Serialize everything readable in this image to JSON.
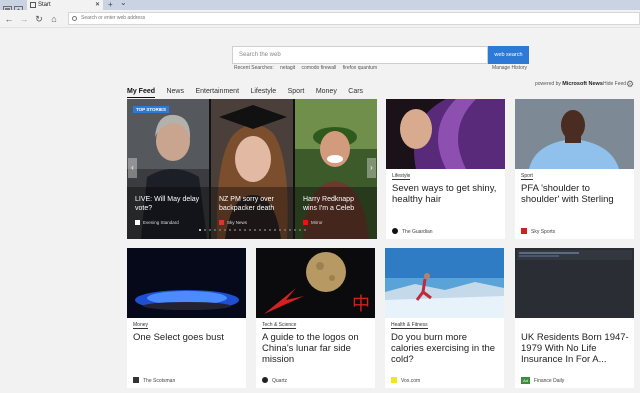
{
  "browser": {
    "tab_title": "Start",
    "new_tab": "+",
    "tab_menu": "⌄",
    "address_placeholder": "Search or enter web address"
  },
  "search": {
    "placeholder": "Search the web",
    "button_label": "web search",
    "recent_label": "Recent Searches:",
    "recent_items": [
      "netagit",
      "comodo firewall",
      "firefox quantum"
    ],
    "manage_history": "Manage History"
  },
  "categories": [
    "My Feed",
    "News",
    "Entertainment",
    "Lifestyle",
    "Sport",
    "Money",
    "Cars"
  ],
  "active_category": "My Feed",
  "powered_by": {
    "prefix": "powered by",
    "brand": "Microsoft News"
  },
  "hide_feed": "Hide Feed",
  "top_stories": {
    "badge": "TOP STORIES",
    "slides": [
      {
        "caption": "LIVE: Will May delay vote?",
        "source": "Evening Standard"
      },
      {
        "caption": "NZ PM sorry over backpacker death",
        "source": "Sky News"
      },
      {
        "caption": "Harry Redknapp wins I'm a Celeb",
        "source": "Mirror"
      }
    ],
    "prev": "‹",
    "next": "›",
    "dot_count": 22,
    "active_dot": 0
  },
  "cards": [
    {
      "category": "Lifestyle",
      "headline": "Seven ways to get shiny, healthy hair",
      "source": "The Guardian"
    },
    {
      "category": "Sport",
      "headline": "PFA 'shoulder to shoulder' with Sterling",
      "source": "Sky Sports"
    },
    {
      "category": "Money",
      "headline": "One Select goes bust",
      "source": "The Scotsman"
    },
    {
      "category": "Tech & Science",
      "headline": "A guide to the logos on China's lunar far side mission",
      "source": "Quartz"
    },
    {
      "category": "Health & Fitness",
      "headline": "Do you burn more calories exercising in the cold?",
      "source": "Vox.com"
    },
    {
      "category": "",
      "headline": "UK Residents Born 1947-1979 With No Life Insurance In For A...",
      "source": "Finance Daily",
      "ad_label": "Ad"
    }
  ],
  "colors": {
    "accent": "#2d7ad6",
    "titlebar": "#c9d3e2"
  }
}
